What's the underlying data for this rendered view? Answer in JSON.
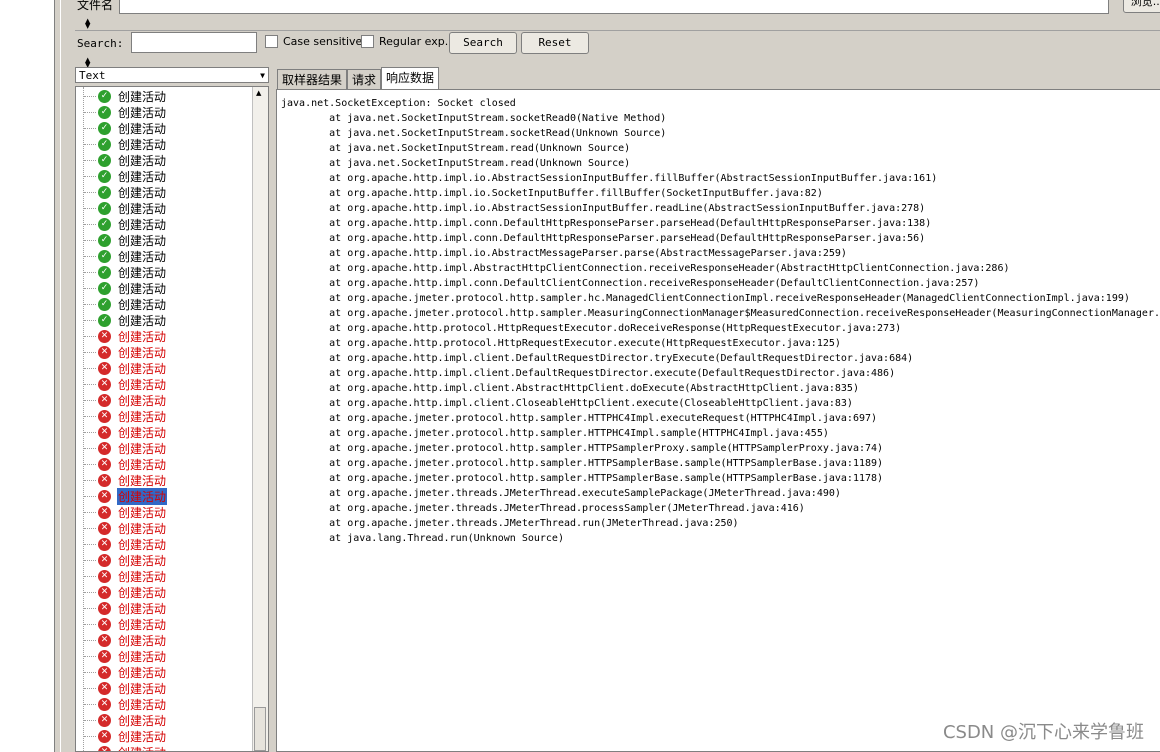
{
  "file_row": {
    "label": "文件名",
    "browse_label": "浏览..."
  },
  "search": {
    "label": "Search:",
    "value": "",
    "case_sensitive_label": "Case sensitive",
    "regex_label": "Regular exp.",
    "search_button": "Search",
    "reset_button": "Reset"
  },
  "results": {
    "renderer_selected": "Text",
    "items": [
      {
        "label": "创建活动",
        "status": "ok"
      },
      {
        "label": "创建活动",
        "status": "ok"
      },
      {
        "label": "创建活动",
        "status": "ok"
      },
      {
        "label": "创建活动",
        "status": "ok"
      },
      {
        "label": "创建活动",
        "status": "ok"
      },
      {
        "label": "创建活动",
        "status": "ok"
      },
      {
        "label": "创建活动",
        "status": "ok"
      },
      {
        "label": "创建活动",
        "status": "ok"
      },
      {
        "label": "创建活动",
        "status": "ok"
      },
      {
        "label": "创建活动",
        "status": "ok"
      },
      {
        "label": "创建活动",
        "status": "ok"
      },
      {
        "label": "创建活动",
        "status": "ok"
      },
      {
        "label": "创建活动",
        "status": "ok"
      },
      {
        "label": "创建活动",
        "status": "ok"
      },
      {
        "label": "创建活动",
        "status": "ok"
      },
      {
        "label": "创建活动",
        "status": "err"
      },
      {
        "label": "创建活动",
        "status": "err"
      },
      {
        "label": "创建活动",
        "status": "err"
      },
      {
        "label": "创建活动",
        "status": "err"
      },
      {
        "label": "创建活动",
        "status": "err"
      },
      {
        "label": "创建活动",
        "status": "err"
      },
      {
        "label": "创建活动",
        "status": "err"
      },
      {
        "label": "创建活动",
        "status": "err"
      },
      {
        "label": "创建活动",
        "status": "err"
      },
      {
        "label": "创建活动",
        "status": "err"
      },
      {
        "label": "创建活动",
        "status": "err",
        "selected": true
      },
      {
        "label": "创建活动",
        "status": "err"
      },
      {
        "label": "创建活动",
        "status": "err"
      },
      {
        "label": "创建活动",
        "status": "err"
      },
      {
        "label": "创建活动",
        "status": "err"
      },
      {
        "label": "创建活动",
        "status": "err"
      },
      {
        "label": "创建活动",
        "status": "err"
      },
      {
        "label": "创建活动",
        "status": "err"
      },
      {
        "label": "创建活动",
        "status": "err"
      },
      {
        "label": "创建活动",
        "status": "err"
      },
      {
        "label": "创建活动",
        "status": "err"
      },
      {
        "label": "创建活动",
        "status": "err"
      },
      {
        "label": "创建活动",
        "status": "err"
      },
      {
        "label": "创建活动",
        "status": "err"
      },
      {
        "label": "创建活动",
        "status": "err"
      },
      {
        "label": "创建活动",
        "status": "err"
      },
      {
        "label": "创建活动",
        "status": "err"
      }
    ]
  },
  "tabs": [
    {
      "label": "取样器结果",
      "active": false
    },
    {
      "label": "请求",
      "active": false
    },
    {
      "label": "响应数据",
      "active": true
    }
  ],
  "response_lines": [
    "java.net.SocketException: Socket closed",
    "\tat java.net.SocketInputStream.socketRead0(Native Method)",
    "\tat java.net.SocketInputStream.socketRead(Unknown Source)",
    "\tat java.net.SocketInputStream.read(Unknown Source)",
    "\tat java.net.SocketInputStream.read(Unknown Source)",
    "\tat org.apache.http.impl.io.AbstractSessionInputBuffer.fillBuffer(AbstractSessionInputBuffer.java:161)",
    "\tat org.apache.http.impl.io.SocketInputBuffer.fillBuffer(SocketInputBuffer.java:82)",
    "\tat org.apache.http.impl.io.AbstractSessionInputBuffer.readLine(AbstractSessionInputBuffer.java:278)",
    "\tat org.apache.http.impl.conn.DefaultHttpResponseParser.parseHead(DefaultHttpResponseParser.java:138)",
    "\tat org.apache.http.impl.conn.DefaultHttpResponseParser.parseHead(DefaultHttpResponseParser.java:56)",
    "\tat org.apache.http.impl.io.AbstractMessageParser.parse(AbstractMessageParser.java:259)",
    "\tat org.apache.http.impl.AbstractHttpClientConnection.receiveResponseHeader(AbstractHttpClientConnection.java:286)",
    "\tat org.apache.http.impl.conn.DefaultClientConnection.receiveResponseHeader(DefaultClientConnection.java:257)",
    "\tat org.apache.jmeter.protocol.http.sampler.hc.ManagedClientConnectionImpl.receiveResponseHeader(ManagedClientConnectionImpl.java:199)",
    "\tat org.apache.jmeter.protocol.http.sampler.MeasuringConnectionManager$MeasuredConnection.receiveResponseHeader(MeasuringConnectionManager.j",
    "\tat org.apache.http.protocol.HttpRequestExecutor.doReceiveResponse(HttpRequestExecutor.java:273)",
    "\tat org.apache.http.protocol.HttpRequestExecutor.execute(HttpRequestExecutor.java:125)",
    "\tat org.apache.http.impl.client.DefaultRequestDirector.tryExecute(DefaultRequestDirector.java:684)",
    "\tat org.apache.http.impl.client.DefaultRequestDirector.execute(DefaultRequestDirector.java:486)",
    "\tat org.apache.http.impl.client.AbstractHttpClient.doExecute(AbstractHttpClient.java:835)",
    "\tat org.apache.http.impl.client.CloseableHttpClient.execute(CloseableHttpClient.java:83)",
    "\tat org.apache.jmeter.protocol.http.sampler.HTTPHC4Impl.executeRequest(HTTPHC4Impl.java:697)",
    "\tat org.apache.jmeter.protocol.http.sampler.HTTPHC4Impl.sample(HTTPHC4Impl.java:455)",
    "\tat org.apache.jmeter.protocol.http.sampler.HTTPSamplerProxy.sample(HTTPSamplerProxy.java:74)",
    "\tat org.apache.jmeter.protocol.http.sampler.HTTPSamplerBase.sample(HTTPSamplerBase.java:1189)",
    "\tat org.apache.jmeter.protocol.http.sampler.HTTPSamplerBase.sample(HTTPSamplerBase.java:1178)",
    "\tat org.apache.jmeter.threads.JMeterThread.executeSamplePackage(JMeterThread.java:490)",
    "\tat org.apache.jmeter.threads.JMeterThread.processSampler(JMeterThread.java:416)",
    "\tat org.apache.jmeter.threads.JMeterThread.run(JMeterThread.java:250)",
    "\tat java.lang.Thread.run(Unknown Source)"
  ],
  "watermark": "CSDN @沉下心来学鲁班",
  "icons": {
    "ok": "check-shield-icon",
    "err": "x-shield-icon"
  },
  "colors": {
    "ok": "#2ea02e",
    "err": "#d42a2a",
    "error_text": "#d40000",
    "selection": "#3169c6"
  }
}
